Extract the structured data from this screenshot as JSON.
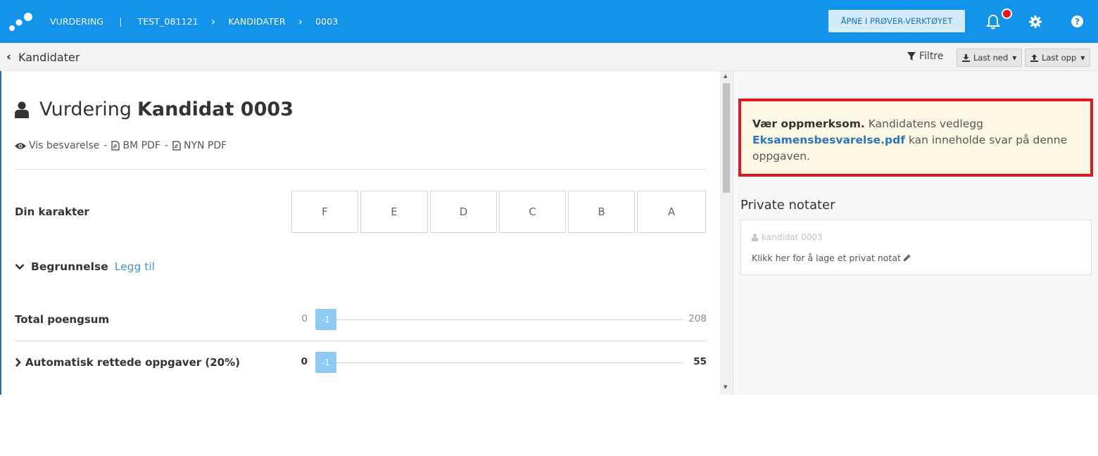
{
  "topbar": {
    "crumb1": "VURDERING",
    "sep": "|",
    "crumb2": "TEST_081121",
    "crumb3": "KANDIDATER",
    "crumb4": "0003",
    "open_button": "ÅPNE I PRØVER-VERKTØYET",
    "help_glyph": "?"
  },
  "subbar": {
    "back_label": "Kandidater",
    "filter_label": "Filtre",
    "download_label": "Last ned",
    "upload_label": "Last opp"
  },
  "main": {
    "title_prefix": "Vurdering",
    "title_name": "Kandidat 0003",
    "links": {
      "view": "Vis besvarelse",
      "dash": "-",
      "bm": "BM PDF",
      "nyn": "NYN PDF"
    },
    "grade_label": "Din karakter",
    "grades": [
      "F",
      "E",
      "D",
      "C",
      "B",
      "A"
    ],
    "reasoning_label": "Begrunnelse",
    "reasoning_add": "Legg til",
    "total": {
      "label": "Total poengsum",
      "min": "0",
      "value": "-1",
      "max": "208"
    },
    "auto": {
      "label": "Automatisk rettede oppgaver (20%)",
      "min": "0",
      "value": "-1",
      "max": "55"
    }
  },
  "alert": {
    "strong": "Vær oppmerksom.",
    "text1": "Kandidatens vedlegg",
    "file": "Eksamensbesvarelse.pdf",
    "text2": "kan inneholde svar på denne oppgaven."
  },
  "notes": {
    "title": "Private notater",
    "user": "kandidat 0003",
    "hint": "Klikk her for å lage et privat notat"
  },
  "colors": {
    "topbar": "#1392ea",
    "alert_border": "#e01a24",
    "alert_bg": "#fcf8e3",
    "link": "#2d74b9",
    "slider_handle": "#8ec9f3"
  },
  "icons": [
    "logo-icon",
    "chevron-right-icon",
    "bell-icon",
    "gear-icon",
    "help-icon",
    "chevron-left-icon",
    "filter-icon",
    "download-icon",
    "upload-icon",
    "user-icon",
    "eye-icon",
    "pdf-icon",
    "chevron-down-icon",
    "pencil-icon"
  ]
}
